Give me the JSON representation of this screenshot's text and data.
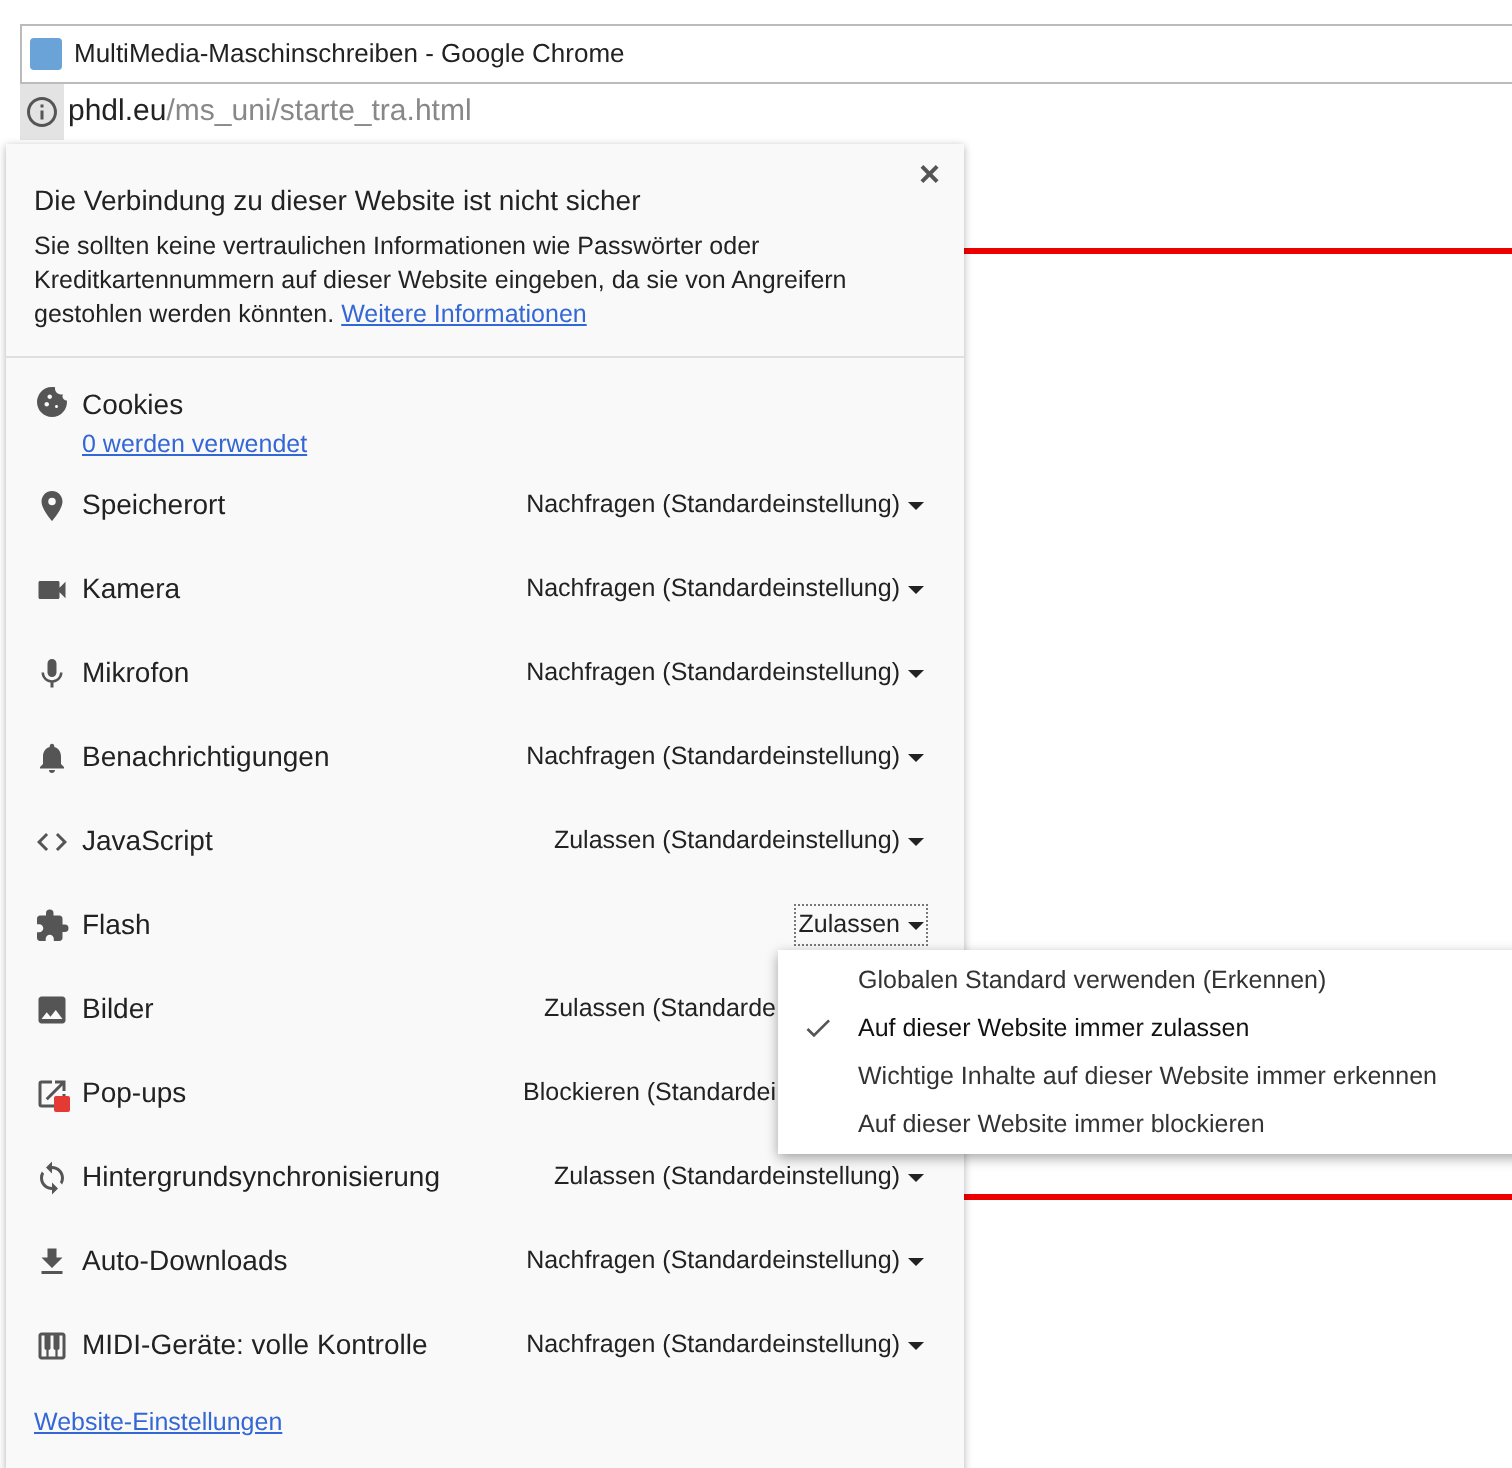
{
  "window": {
    "title": "MultiMedia-Maschinschreiben - Google Chrome"
  },
  "address_bar": {
    "host": "phdl.eu",
    "path": "/ms_uni/starte_tra.html"
  },
  "site_info": {
    "close": "×",
    "heading": "Die Verbindung zu dieser Website ist nicht sicher",
    "message": "Sie sollten keine vertraulichen Informationen wie Passwörter oder Kreditkartennummern auf dieser Website eingeben, da sie von Angreifern gestohlen werden könnten.",
    "message_link": "Weitere Informationen",
    "cookies": {
      "label": "Cookies",
      "link": "0 werden verwendet"
    },
    "permissions": [
      {
        "label": "Speicherort",
        "value": "Nachfragen (Standardeinstellung)",
        "caret": true,
        "expanded": false
      },
      {
        "label": "Kamera",
        "value": "Nachfragen (Standardeinstellung)",
        "caret": true,
        "expanded": false
      },
      {
        "label": "Mikrofon",
        "value": "Nachfragen (Standardeinstellung)",
        "caret": true,
        "expanded": false
      },
      {
        "label": "Benachrichtigungen",
        "value": "Nachfragen (Standardeinstellung)",
        "caret": true,
        "expanded": false
      },
      {
        "label": "JavaScript",
        "value": "Zulassen (Standardeinstellung)",
        "caret": true,
        "expanded": false
      },
      {
        "label": "Flash",
        "value": "Zulassen",
        "caret": true,
        "expanded": true
      },
      {
        "label": "Bilder",
        "value": "Zulassen (Standarde",
        "caret": false,
        "expanded": false
      },
      {
        "label": "Pop-ups",
        "value": "Blockieren (Standardei",
        "caret": false,
        "expanded": false
      },
      {
        "label": "Hintergrundsynchronisierung",
        "value": "Zulassen (Standardeinstellung)",
        "caret": true,
        "expanded": false
      },
      {
        "label": "Auto-Downloads",
        "value": "Nachfragen (Standardeinstellung)",
        "caret": true,
        "expanded": false
      },
      {
        "label": "MIDI-Geräte: volle Kontrolle",
        "value": "Nachfragen (Standardeinstellung)",
        "caret": true,
        "expanded": false
      }
    ],
    "footer_link": "Website-Einstellungen"
  },
  "dropdown_menu": [
    {
      "label": "Globalen Standard verwenden (Erkennen)",
      "selected": false
    },
    {
      "label": "Auf dieser Website immer zulassen",
      "selected": true
    },
    {
      "label": "Wichtige Inhalte auf dieser Website immer erkennen",
      "selected": false
    },
    {
      "label": "Auf dieser Website immer blockieren",
      "selected": false
    }
  ]
}
